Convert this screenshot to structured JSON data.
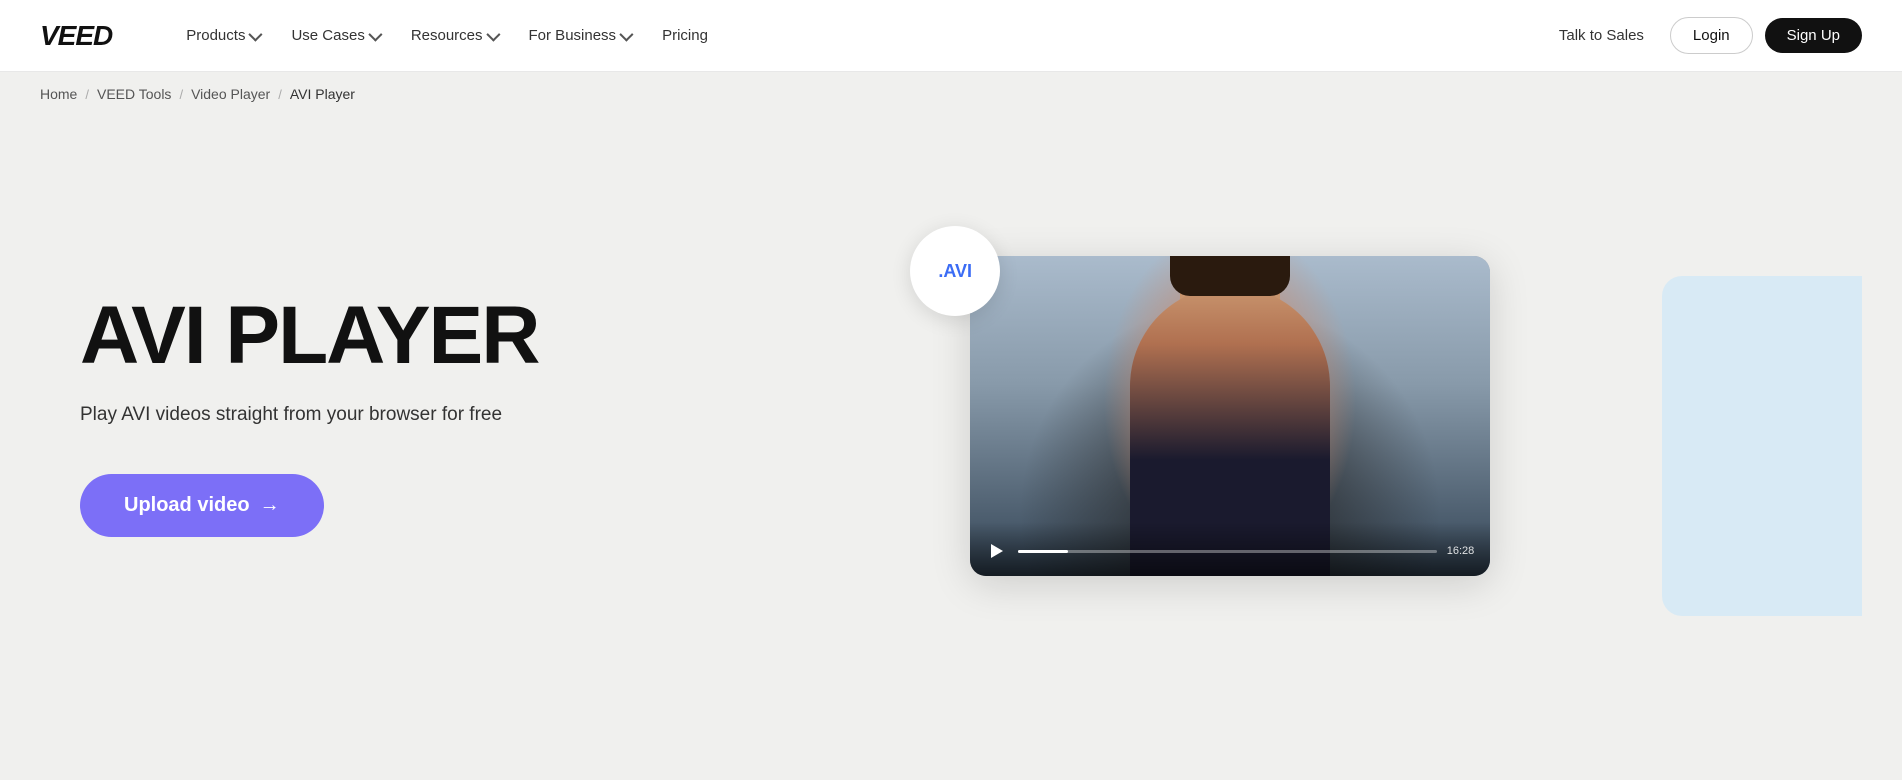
{
  "header": {
    "logo": "VEED",
    "nav": [
      {
        "label": "Products",
        "hasDropdown": true
      },
      {
        "label": "Use Cases",
        "hasDropdown": true
      },
      {
        "label": "Resources",
        "hasDropdown": true
      },
      {
        "label": "For Business",
        "hasDropdown": true
      },
      {
        "label": "Pricing",
        "hasDropdown": false
      }
    ],
    "talk_to_sales": "Talk to Sales",
    "login": "Login",
    "signup": "Sign Up"
  },
  "breadcrumb": [
    {
      "label": "Home",
      "active": false
    },
    {
      "label": "VEED Tools",
      "active": false
    },
    {
      "label": "Video Player",
      "active": false
    },
    {
      "label": "AVI Player",
      "active": true
    }
  ],
  "hero": {
    "title": "AVI PLAYER",
    "subtitle": "Play AVI videos straight from your browser for free",
    "upload_btn": "Upload video",
    "upload_arrow": "→"
  },
  "video": {
    "avi_badge": ".AVI",
    "time": "16:28"
  }
}
